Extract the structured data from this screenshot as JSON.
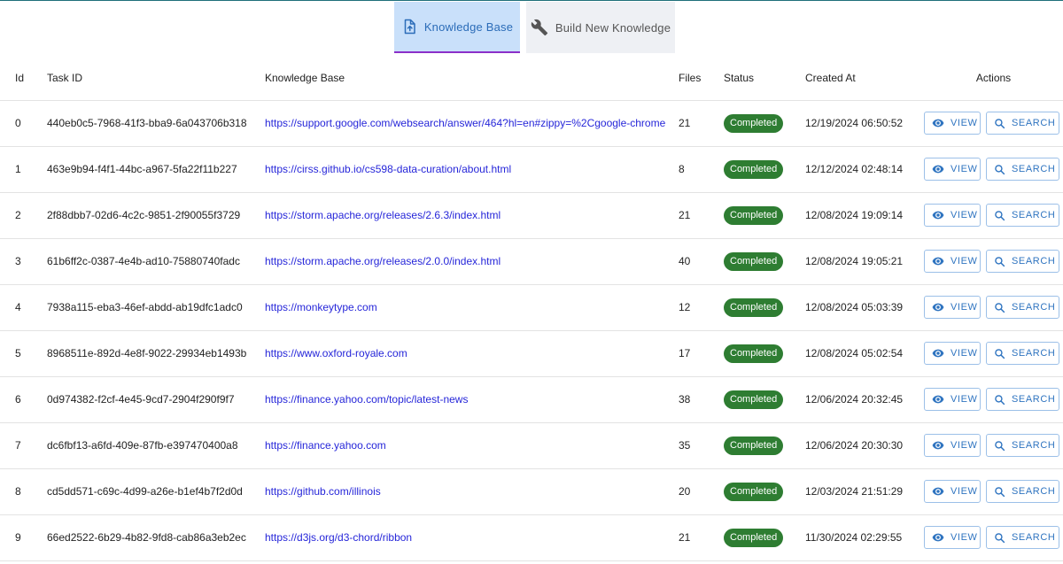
{
  "tabs": [
    {
      "label": "Knowledge Base",
      "icon": "upload-file-icon",
      "active": true
    },
    {
      "label": "Build New Knowledge",
      "icon": "wrench-icon",
      "active": false
    }
  ],
  "table": {
    "headers": {
      "id": "Id",
      "task_id": "Task ID",
      "knowledge_base": "Knowledge Base",
      "files": "Files",
      "status": "Status",
      "created_at": "Created At",
      "actions": "Actions"
    },
    "view_label": "VIEW",
    "search_label": "SEARCH",
    "rows": [
      {
        "id": "0",
        "task_id": "440eb0c5-7968-41f3-bba9-6a043706b318",
        "url": "https://support.google.com/websearch/answer/464?hl=en#zippy=%2Cgoogle-chrome",
        "files": "21",
        "status": "Completed",
        "created_at": "12/19/2024 06:50:52"
      },
      {
        "id": "1",
        "task_id": "463e9b94-f4f1-44bc-a967-5fa22f11b227",
        "url": "https://cirss.github.io/cs598-data-curation/about.html",
        "files": "8",
        "status": "Completed",
        "created_at": "12/12/2024 02:48:14"
      },
      {
        "id": "2",
        "task_id": "2f88dbb7-02d6-4c2c-9851-2f90055f3729",
        "url": "https://storm.apache.org/releases/2.6.3/index.html",
        "files": "21",
        "status": "Completed",
        "created_at": "12/08/2024 19:09:14"
      },
      {
        "id": "3",
        "task_id": "61b6ff2c-0387-4e4b-ad10-75880740fadc",
        "url": "https://storm.apache.org/releases/2.0.0/index.html",
        "files": "40",
        "status": "Completed",
        "created_at": "12/08/2024 19:05:21"
      },
      {
        "id": "4",
        "task_id": "7938a115-eba3-46ef-abdd-ab19dfc1adc0",
        "url": "https://monkeytype.com",
        "files": "12",
        "status": "Completed",
        "created_at": "12/08/2024 05:03:39"
      },
      {
        "id": "5",
        "task_id": "8968511e-892d-4e8f-9022-29934eb1493b",
        "url": "https://www.oxford-royale.com",
        "files": "17",
        "status": "Completed",
        "created_at": "12/08/2024 05:02:54"
      },
      {
        "id": "6",
        "task_id": "0d974382-f2cf-4e45-9cd7-2904f290f9f7",
        "url": "https://finance.yahoo.com/topic/latest-news",
        "files": "38",
        "status": "Completed",
        "created_at": "12/06/2024 20:32:45"
      },
      {
        "id": "7",
        "task_id": "dc6fbf13-a6fd-409e-87fb-e397470400a8",
        "url": "https://finance.yahoo.com",
        "files": "35",
        "status": "Completed",
        "created_at": "12/06/2024 20:30:30"
      },
      {
        "id": "8",
        "task_id": "cd5dd571-c69c-4d99-a26e-b1ef4b7f2d0d",
        "url": "https://github.com/illinois",
        "files": "20",
        "status": "Completed",
        "created_at": "12/03/2024 21:51:29"
      },
      {
        "id": "9",
        "task_id": "66ed2522-6b29-4b82-9fd8-cab86a3eb2ec",
        "url": "https://d3js.org/d3-chord/ribbon",
        "files": "21",
        "status": "Completed",
        "created_at": "11/30/2024 02:29:55"
      }
    ]
  },
  "colors": {
    "active_tab_bg": "#c9e0fa",
    "active_tab_underline": "#8b2fc9",
    "status_completed": "#2e7d32",
    "link": "#2626d9",
    "button_accent": "#2f74c0"
  }
}
